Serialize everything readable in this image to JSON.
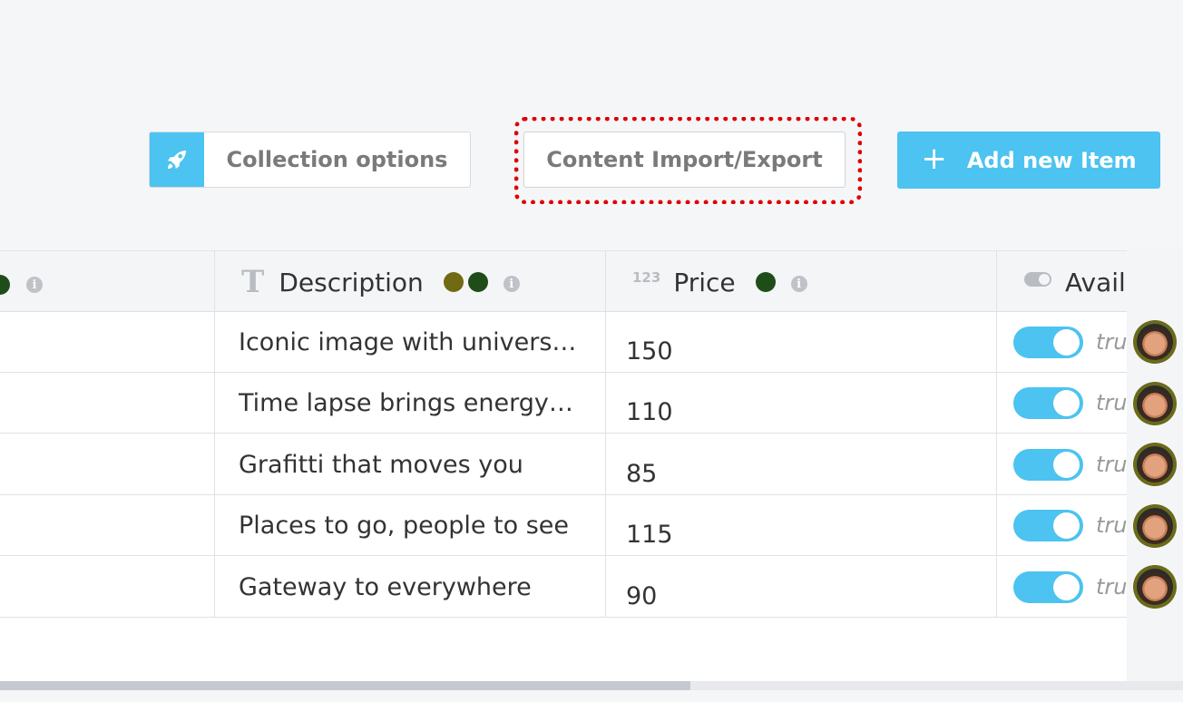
{
  "toolbar": {
    "collection_options_label": "Collection options",
    "import_export_label": "Content Import/Export",
    "add_item_plus": "+",
    "add_item_label": "Add new Item"
  },
  "columns": {
    "description": {
      "type_icon": "T",
      "title": "Description",
      "dot_colors": [
        "#726a12",
        "#1f4d1a"
      ]
    },
    "price": {
      "type_icon": "123",
      "title": "Price",
      "dot_colors": [
        "#1f4d1a"
      ]
    },
    "available": {
      "title": "Avail"
    },
    "info_glyph": "i"
  },
  "rows": [
    {
      "description": "Iconic image with univers…",
      "price": "150",
      "available": "tru"
    },
    {
      "description": "Time lapse brings energy…",
      "price": "110",
      "available": "tru"
    },
    {
      "description": "Grafitti that moves you",
      "price": "85",
      "available": "tru"
    },
    {
      "description": "Places to go, people to see",
      "price": "115",
      "available": "tru"
    },
    {
      "description": "Gateway to everywhere",
      "price": "90",
      "available": "tru"
    }
  ],
  "colors": {
    "accent": "#4cc3f0",
    "highlight": "#e00000"
  },
  "scroll_position": 0
}
